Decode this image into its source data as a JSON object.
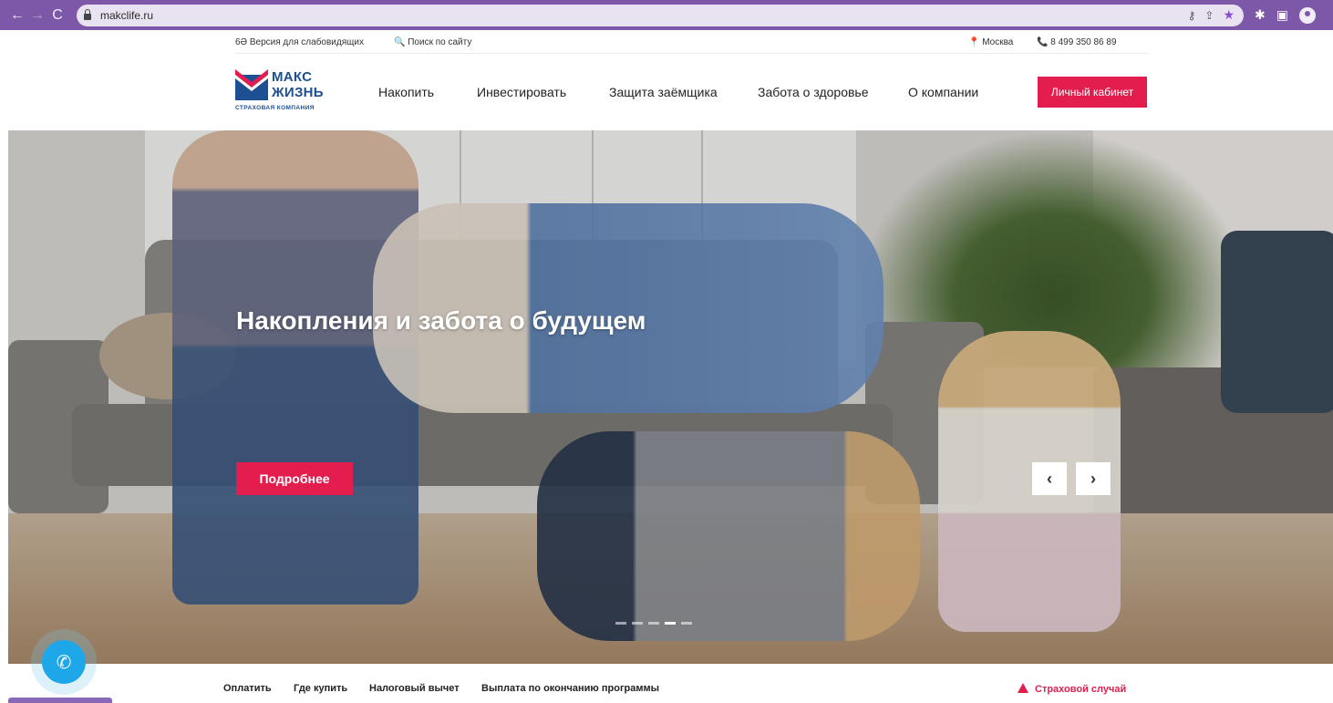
{
  "browser": {
    "url": "makclife.ru",
    "back_icon": "←",
    "forward_icon": "→",
    "reload_icon": "C"
  },
  "utility": {
    "accessibility": "6Ə Версия для слабовидящих",
    "search": "🔍 Поиск по сайту",
    "city": "📍 Москва",
    "phone": "📞 8 499 350 86 89"
  },
  "logo": {
    "line1": "МАКС",
    "line2": "ЖИЗНЬ",
    "tagline": "СТРАХОВАЯ КОМПАНИЯ"
  },
  "nav": {
    "items": [
      "Накопить",
      "Инвестировать",
      "Защита заёмщика",
      "Забота о здоровье",
      "О компании"
    ],
    "account": "Личный кабинет"
  },
  "hero": {
    "title": "Накопления и забота о будущем",
    "cta": "Подробнее",
    "prev": "‹",
    "next": "›",
    "slides_total": 5,
    "active_slide": 4
  },
  "bottom": {
    "links": [
      "Оплатить",
      "Где купить",
      "Налоговый вычет",
      "Выплата по окончанию программы"
    ],
    "insured_case": "Страховой случай"
  },
  "colors": {
    "accent": "#e31e4f",
    "brand": "#1d4f93",
    "chrome": "#7d58a8",
    "call": "#1ea7e8"
  }
}
